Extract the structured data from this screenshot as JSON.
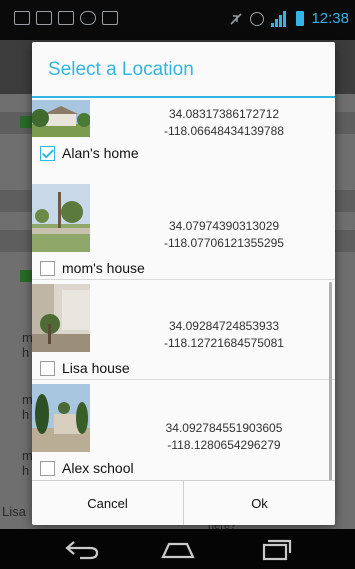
{
  "status_bar": {
    "time": "12:38"
  },
  "background": {
    "fragments": [
      "m",
      "h",
      "m",
      "h",
      "m",
      "h",
      "Lisa",
      "here?"
    ]
  },
  "dialog": {
    "title": "Select a Location",
    "items": [
      {
        "lat": "34.08317386172712",
        "lng": "-118.06648434139788",
        "name": "Alan's home",
        "checked": true
      },
      {
        "lat": "34.07974390313029",
        "lng": "-118.07706121355295",
        "name": "mom's house",
        "checked": false
      },
      {
        "lat": "34.09284724853933",
        "lng": "-118.12721684575081",
        "name": "Lisa house",
        "checked": false
      },
      {
        "lat": "34.092784551903605",
        "lng": "-118.1280654296279",
        "name": "Alex school",
        "checked": false
      }
    ],
    "cancel_label": "Cancel",
    "ok_label": "Ok"
  },
  "icons": {
    "status": [
      "notification-icon",
      "image-icon",
      "gmail-icon",
      "voicemail-icon",
      "task-icon",
      "mute-icon",
      "alarm-icon",
      "signal-icon",
      "battery-icon"
    ],
    "nav": [
      "back-icon",
      "home-icon",
      "recent-apps-icon"
    ]
  },
  "colors": {
    "accent": "#33b5e5"
  }
}
